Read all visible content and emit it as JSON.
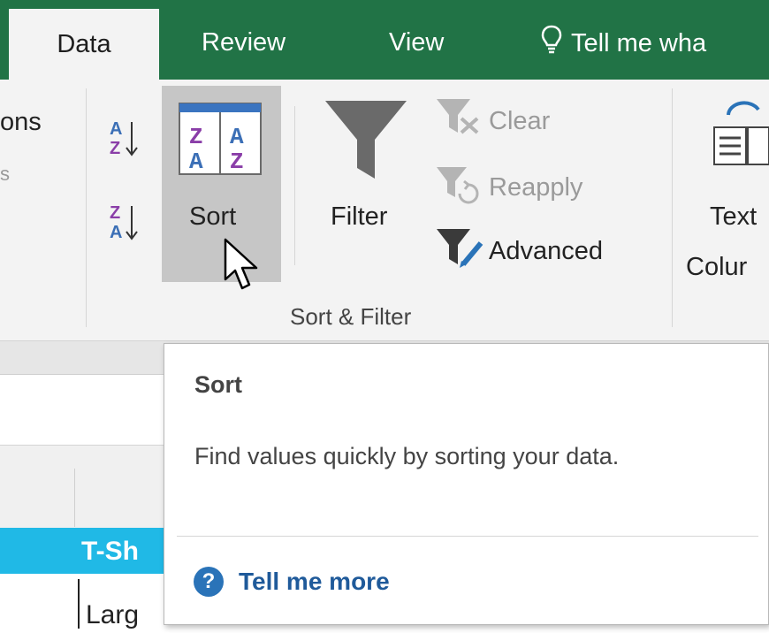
{
  "tabs": {
    "data": "Data",
    "review": "Review",
    "view": "View",
    "tell_me": "Tell me wha"
  },
  "ribbon": {
    "left_partial_top": "ons",
    "left_partial_mid": "s",
    "sort_label": "Sort",
    "filter_label": "Filter",
    "clear_label": "Clear",
    "reapply_label": "Reapply",
    "advanced_label": "Advanced",
    "group_label": "Sort & Filter",
    "text_to_columns_line1": "Text",
    "text_to_columns_line2": "Colur"
  },
  "sheet": {
    "header_cell": "T-Sh",
    "cell_fragment": "Larg"
  },
  "tooltip": {
    "title": "Sort",
    "description": "Find values quickly by sorting your data.",
    "tell_me_more": "Tell me more"
  },
  "colors": {
    "excel_green": "#217346",
    "sort_highlight": "#c6c6c6",
    "header_cyan": "#20b9e6",
    "link_blue": "#1f5a9a"
  }
}
